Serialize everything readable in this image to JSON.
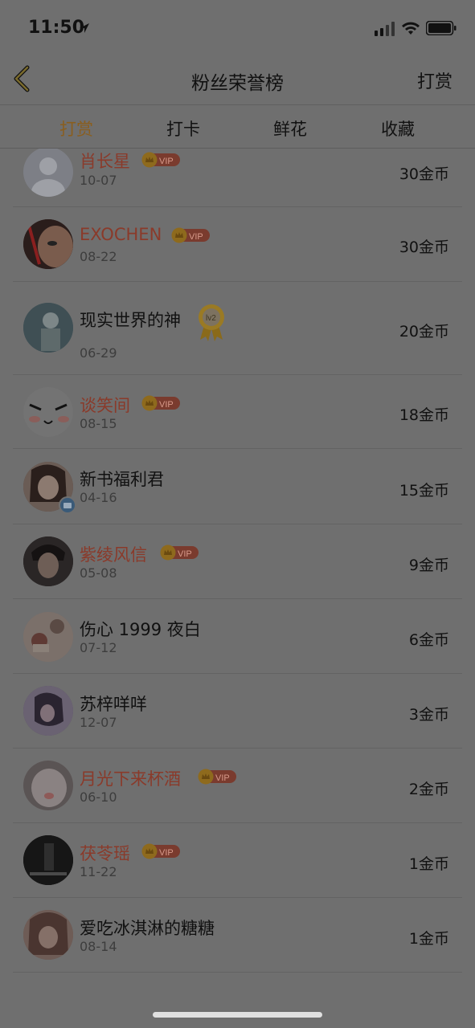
{
  "status": {
    "time": "11:50"
  },
  "nav": {
    "title": "粉丝荣誉榜",
    "action": "打赏"
  },
  "tabs": [
    {
      "label": "打赏",
      "active": true
    },
    {
      "label": "打卡",
      "active": false
    },
    {
      "label": "鲜花",
      "active": false
    },
    {
      "label": "收藏",
      "active": false
    }
  ],
  "vip_label": "VIP",
  "level_badge": "lv2",
  "rows": [
    {
      "name": "肖长星",
      "date": "10-07",
      "amount": "30金币",
      "vip": true
    },
    {
      "name": "EXOCHEN",
      "date": "08-22",
      "amount": "30金币",
      "vip": true
    },
    {
      "name": "现实世界的神",
      "date": "06-29",
      "amount": "20金币",
      "vip": false,
      "level": "lv2"
    },
    {
      "name": "谈笑间",
      "date": "08-15",
      "amount": "18金币",
      "vip": true
    },
    {
      "name": "新书福利君",
      "date": "04-16",
      "amount": "15金币",
      "vip": false
    },
    {
      "name": "紫绫风信",
      "date": "05-08",
      "amount": "9金币",
      "vip": true
    },
    {
      "name": "伤心 1999 夜白",
      "date": "07-12",
      "amount": "6金币",
      "vip": false
    },
    {
      "name": "苏梓咩咩",
      "date": "12-07",
      "amount": "3金币",
      "vip": false
    },
    {
      "name": "月光下来杯酒",
      "date": "06-10",
      "amount": "2金币",
      "vip": true
    },
    {
      "name": "茯苓瑶",
      "date": "11-22",
      "amount": "1金币",
      "vip": true
    },
    {
      "name": "爱吃冰淇淋的糖糖",
      "date": "08-14",
      "amount": "1金币",
      "vip": false
    }
  ],
  "colors": {
    "overlay": "#6f6f6f",
    "vip_name": "#8a3a2a",
    "active_tab": "#8a5e1e"
  }
}
